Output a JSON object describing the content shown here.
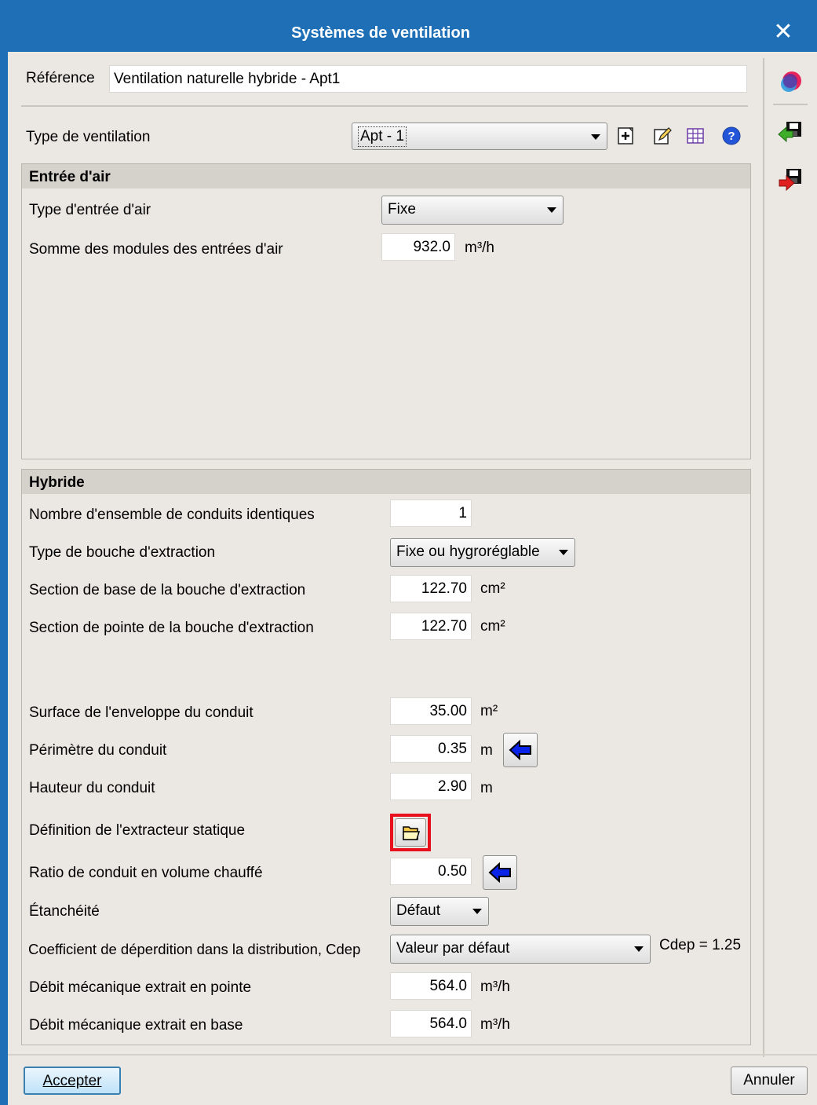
{
  "window": {
    "title": "Systèmes de ventilation",
    "close_glyph": "✕"
  },
  "reference": {
    "label": "Référence",
    "value": "Ventilation naturelle hybride - Apt1"
  },
  "ventilation_type": {
    "label": "Type de ventilation",
    "selected": "Apt - 1",
    "toolbar_icons": [
      "add-icon",
      "edit-icon",
      "table-icon",
      "help-icon"
    ]
  },
  "side_icons": [
    "color-palette-icon",
    "import-icon",
    "export-icon"
  ],
  "air_inlet": {
    "title": "Entrée d'air",
    "type_label": "Type d'entrée d'air",
    "type_value": "Fixe",
    "sum_label": "Somme des modules des entrées d'air",
    "sum_value": "932.0",
    "sum_unit": "m³/h"
  },
  "hybrid": {
    "title": "Hybride",
    "rows": {
      "nb_conduits": {
        "label": "Nombre d'ensemble de conduits identiques",
        "value": "1"
      },
      "type_bouche": {
        "label": "Type de bouche d'extraction",
        "value": "Fixe ou hygroréglable"
      },
      "section_base": {
        "label": "Section de base de la bouche d'extraction",
        "value": "122.70",
        "unit": "cm²"
      },
      "section_pointe": {
        "label": "Section de pointe de la bouche d'extraction",
        "value": "122.70",
        "unit": "cm²"
      },
      "surface": {
        "label": "Surface de l'enveloppe du conduit",
        "value": "35.00",
        "unit": "m²"
      },
      "perimetre": {
        "label": "Périmètre du conduit",
        "value": "0.35",
        "unit": "m"
      },
      "hauteur": {
        "label": "Hauteur du conduit",
        "value": "2.90",
        "unit": "m"
      },
      "extracteur": {
        "label": "Définition de l'extracteur statique"
      },
      "ratio": {
        "label": "Ratio de conduit en volume chauffé",
        "value": "0.50"
      },
      "etancheite": {
        "label": "Étanchéité",
        "value": "Défaut"
      },
      "cdep": {
        "label": "Coefficient de déperdition dans la distribution, Cdep",
        "value": "Valeur par défaut",
        "note": "Cdep = 1.25"
      },
      "debit_pointe": {
        "label": "Débit mécanique extrait en pointe",
        "value": "564.0",
        "unit": "m³/h"
      },
      "debit_base": {
        "label": "Débit mécanique extrait en base",
        "value": "564.0",
        "unit": "m³/h"
      }
    }
  },
  "buttons": {
    "accept": "Accepter",
    "cancel": "Annuler"
  },
  "colors": {
    "titlebar": "#1e6fb6",
    "highlight": "#e8101c",
    "arrow_blue": "#0a23e8"
  }
}
